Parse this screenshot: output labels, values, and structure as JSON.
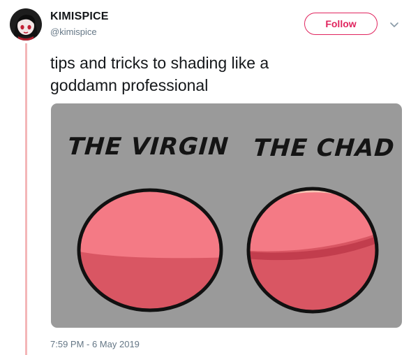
{
  "author": {
    "name": "KIMISPICE",
    "handle": "@kimispice"
  },
  "follow_label": "Follow",
  "tweet": {
    "text_line1": "tips and tricks to shading like a",
    "text_line2": "goddamn professional"
  },
  "image": {
    "left_label": "THE VIRGIN",
    "right_label": "THE CHAD"
  },
  "timestamp": "7:59 PM - 6 May 2019",
  "icons": {
    "avatar": "avatar-illustration",
    "caret": "chevron-down-icon"
  },
  "colors": {
    "accent": "#e0245e",
    "thread_line": "#f4b6b8",
    "media_bg": "#9a9a9a",
    "ball_light": "#f47a85",
    "ball_dark": "#d95663"
  }
}
